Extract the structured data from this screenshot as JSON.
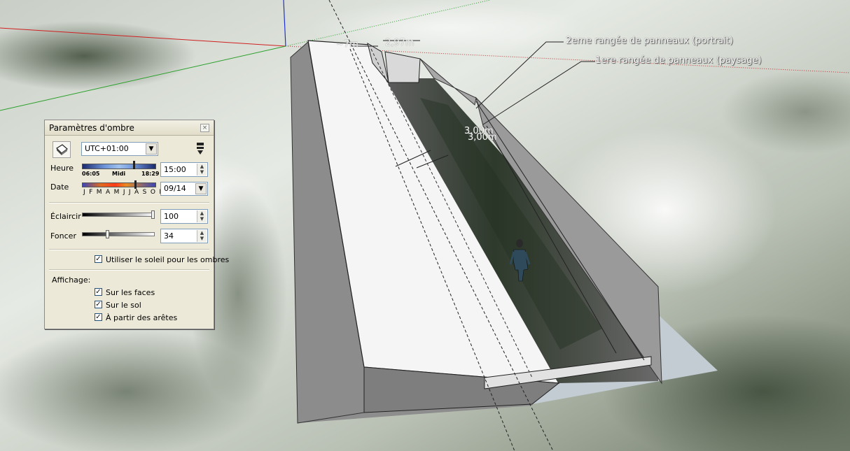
{
  "viewport": {
    "annotations": {
      "row2": "2eme rangée de panneaux (portrait)",
      "row1": "1ere rangée de panneaux (paysage)"
    },
    "dimensions": {
      "top_a": "~7m",
      "top_b": "2,97m",
      "mid_a": "3,00m",
      "mid_b": "3,00m"
    }
  },
  "panel": {
    "title": "Paramètres d'ombre",
    "close_glyph": "×",
    "timezone": "UTC+01:00",
    "heure_label": "Heure",
    "sunrise": "06:05",
    "noon": "Midi",
    "sunset": "18:29",
    "time_value": "15:00",
    "date_label": "Date",
    "months": "J F M A M J J A S O N D",
    "date_value": "09/14",
    "eclaircir_label": "Éclaircir",
    "eclaircir_value": "100",
    "foncer_label": "Foncer",
    "foncer_value": "34",
    "use_sun_label": "Utiliser le soleil pour les ombres",
    "affichage_label": "Affichage:",
    "on_faces_label": "Sur les faces",
    "on_ground_label": "Sur le sol",
    "from_edges_label": "À partir des arêtes",
    "check_glyph": "✓"
  },
  "colors": {
    "panel_bg": "#ece9d8",
    "wall_white": "#f4f4f4",
    "wall_grey": "#8f8f8f",
    "axis_red": "#d02020",
    "axis_green": "#20a020",
    "axis_blue": "#2020d0"
  },
  "slider_levels": {
    "eclaircir": 100,
    "foncer": 34
  }
}
